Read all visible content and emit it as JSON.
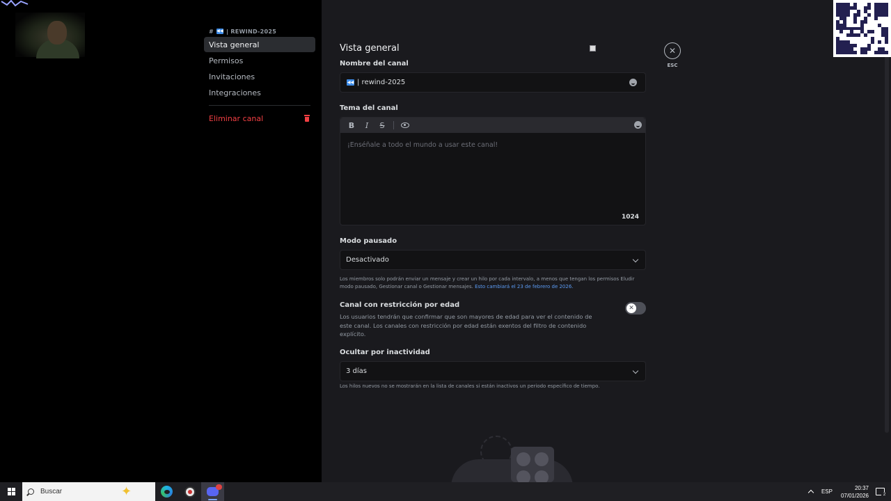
{
  "sidebar": {
    "channel_header": "| REWIND-2025",
    "channel_hash": "#",
    "items": [
      {
        "label": "Vista general",
        "active": true
      },
      {
        "label": "Permisos"
      },
      {
        "label": "Invitaciones"
      },
      {
        "label": "Integraciones"
      }
    ],
    "delete_label": "Eliminar canal"
  },
  "main": {
    "title": "Vista general",
    "channel_name_label": "Nombre del canal",
    "channel_name_value": "| rewind-2025",
    "topic_label": "Tema del canal",
    "topic_placeholder": "¡Enséñale a todo el mundo a usar este canal!",
    "topic_char_count": "1024",
    "slowmode_label": "Modo pausado",
    "slowmode_value": "Desactivado",
    "slowmode_help": "Los miembros solo podrán enviar un mensaje y crear un hilo por cada intervalo, a menos que tengan los permisos Eludir modo pausado, Gestionar canal o Gestionar mensajes.",
    "slowmode_help_link": "Esto cambiará el 23 de febrero de 2026.",
    "age_title": "Canal con restricción por edad",
    "age_desc": "Los usuarios tendrán que confirmar que son mayores de edad para ver el contenido de este canal. Los canales con restricción por edad están exentos del filtro de contenido explícito.",
    "age_enabled": false,
    "inactivity_label": "Ocultar por inactividad",
    "inactivity_value": "3 días",
    "inactivity_help": "Los hilos nuevos no se mostrarán en la lista de canales si están inactivos un periodo específico de tiempo.",
    "close_label": "ESC"
  },
  "toolbar_icons": [
    "bold-icon",
    "italic-icon",
    "strikethrough-icon",
    "eye-icon",
    "emoji-icon"
  ],
  "taskbar": {
    "search_placeholder": "Buscar",
    "lang": "ESP",
    "time": "20:37",
    "date": "07/01/2026",
    "notification_count": "2",
    "apps": [
      "edge-icon",
      "obs-icon",
      "discord-icon"
    ]
  },
  "colors": {
    "background": "#1a1a1e",
    "sidebar": "#000000",
    "danger": "#f23f43",
    "link": "#5c9cf5",
    "accent_emoji": "#3d8ce8"
  }
}
